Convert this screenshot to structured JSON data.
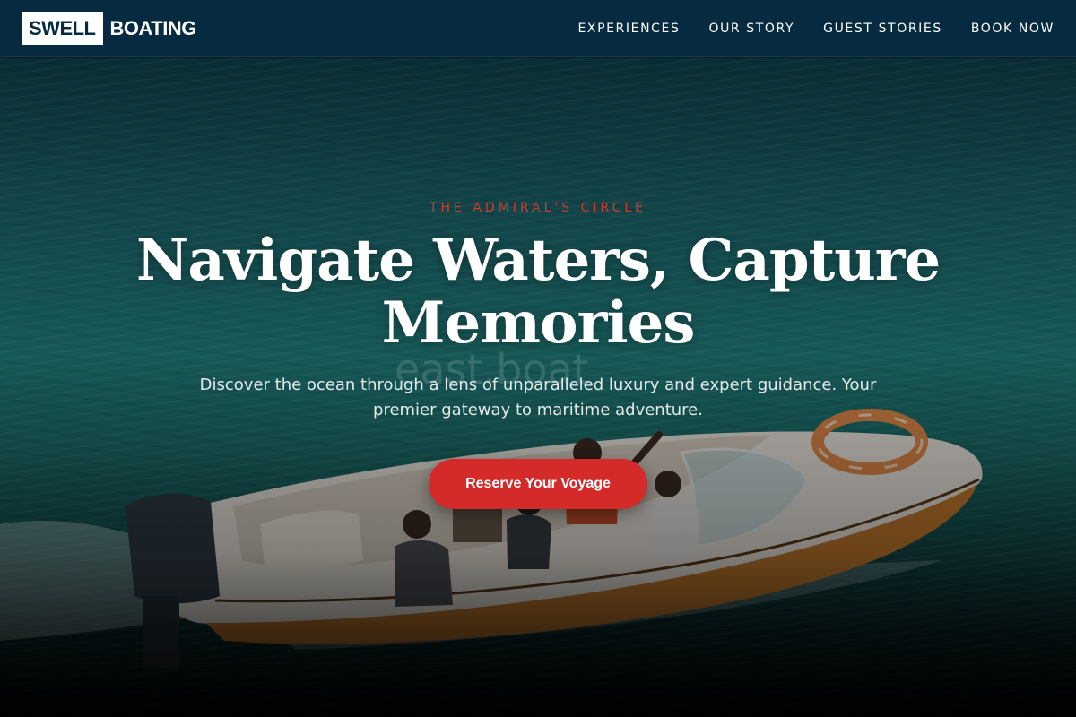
{
  "brand": {
    "logo_box": "SWELL",
    "logo_text": "BOATING"
  },
  "nav": {
    "items": [
      {
        "label": "EXPERIENCES"
      },
      {
        "label": "OUR STORY"
      },
      {
        "label": "GUEST STORIES"
      },
      {
        "label": "BOOK NOW"
      }
    ]
  },
  "hero": {
    "eyebrow": "THE ADMIRAL'S CIRCLE",
    "headline": "Navigate Waters, Capture Memories",
    "subtext": "Discover the ocean through a lens of unparalleled luxury and expert guidance. Your premier gateway to maritime adventure.",
    "cta_label": "Reserve Your Voyage",
    "watermark": "east.boat"
  },
  "colors": {
    "header_bg": "#062a40",
    "accent_red": "#d42a2a",
    "eyebrow_red": "#d23a32",
    "text_white": "#ffffff"
  }
}
